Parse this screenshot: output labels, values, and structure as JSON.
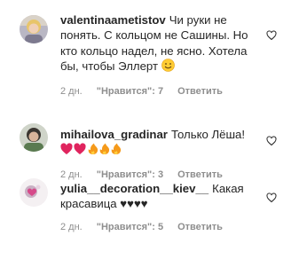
{
  "comments": [
    {
      "username": "valentinaametistov",
      "text": "Чи руки не понять. С кольцом не Сашины. Но кто кольцо надел, не ясно. Хотела бы, чтобы Эллерт",
      "emoji": "smile-emoji",
      "time": "2 дн.",
      "likes": "\"Нравится\": 7",
      "reply": "Ответить"
    },
    {
      "username": "mihailova_gradinar",
      "text": "Только Лёша!",
      "emoji": "hearts-and-fire-emoji",
      "time": "2 дн.",
      "likes": "\"Нравится\": 3",
      "reply": "Ответить"
    },
    {
      "username": "yulia__decoration__kiev__",
      "text": "Какая красавица ♥♥♥♥",
      "time": "2 дн.",
      "likes": "\"Нравится\": 5",
      "reply": "Ответить"
    }
  ],
  "colors": {
    "text": "#262626",
    "meta": "#8e8e8e",
    "heart_red": "#e0245e",
    "fire": "#f59a1b"
  }
}
